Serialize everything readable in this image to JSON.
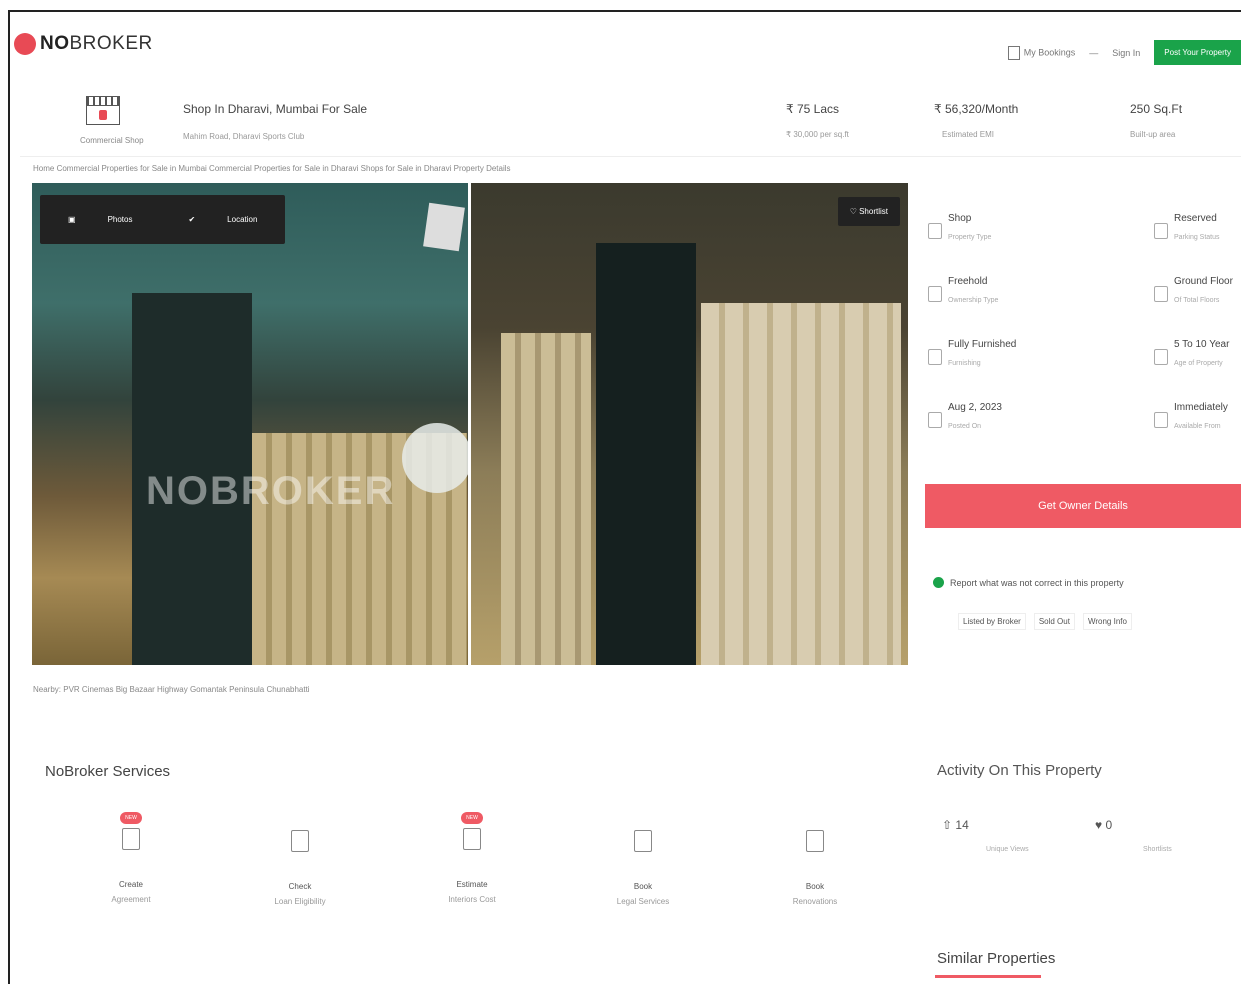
{
  "brand": {
    "name_bold": "NO",
    "name_rest": "BROKER"
  },
  "topnav": {
    "bookings": "My Bookings",
    "signin": "Sign In",
    "post_button": "Post Your Property"
  },
  "property": {
    "category": "Commercial Shop",
    "title": "Shop In Dharavi, Mumbai For Sale",
    "address": "Mahim Road, Dharavi Sports Club",
    "price": "₹ 75 Lacs",
    "price_per_sqft": "₹ 30,000 per sq.ft",
    "emi": "₹ 56,320/Month",
    "emi_label": "Estimated EMI",
    "area": "250 Sq.Ft",
    "area_label": "Built-up area"
  },
  "breadcrumbs": "Home  Commercial Properties for Sale in Mumbai  Commercial Properties for Sale in Dharavi  Shops for Sale in Dharavi  Property Details",
  "gallery": {
    "photos_label": "Photos",
    "location_label": "Location",
    "shortlist_label": "Shortlist",
    "watermark": "NOBROKER"
  },
  "details": [
    {
      "value": "Shop",
      "label": "Property Type",
      "icon": "shop-icon"
    },
    {
      "value": "Reserved",
      "label": "Parking Status",
      "icon": "parking-icon"
    },
    {
      "value": "Freehold",
      "label": "Ownership Type",
      "icon": "ownership-icon"
    },
    {
      "value": "Ground Floor",
      "label": "Of Total Floors",
      "icon": "floor-icon"
    },
    {
      "value": "Fully Furnished",
      "label": "Furnishing",
      "icon": "furnishing-icon"
    },
    {
      "value": "5 To 10 Year",
      "label": "Age of Property",
      "icon": "age-icon"
    },
    {
      "value": "Aug 2, 2023",
      "label": "Posted On",
      "icon": "calendar-icon"
    },
    {
      "value": "Immediately",
      "label": "Available From",
      "icon": "availability-icon"
    }
  ],
  "owner_button": "Get Owner Details",
  "report": {
    "text": "Report what was not correct in this property",
    "options": [
      "Listed by Broker",
      "Sold Out",
      "Wrong Info"
    ]
  },
  "nearby": "Nearby:  PVR Cinemas   Big Bazaar   Highway Gomantak   Peninsula   Chunabhatti",
  "services": {
    "title": "NoBroker Services",
    "new_badge": "NEW",
    "items": [
      {
        "line1": "Create",
        "line2": "Agreement",
        "icon": "agreement-icon",
        "is_new": true
      },
      {
        "line1": "Check",
        "line2": "Loan Eligibility",
        "icon": "loan-icon",
        "is_new": false
      },
      {
        "line1": "Estimate",
        "line2": "Interiors Cost",
        "icon": "interiors-icon",
        "is_new": true
      },
      {
        "line1": "Book",
        "line2": "Legal Services",
        "icon": "legal-icon",
        "is_new": false
      },
      {
        "line1": "Book",
        "line2": "Renovations",
        "icon": "renovation-icon",
        "is_new": false
      }
    ]
  },
  "activity": {
    "title": "Activity On This Property",
    "views": "14",
    "views_label": "Unique Views",
    "shortlists": "0",
    "shortlists_label": "Shortlists"
  },
  "similar_title": "Similar Properties"
}
